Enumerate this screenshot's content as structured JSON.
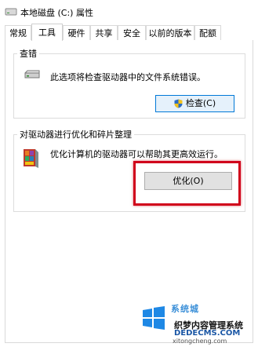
{
  "window": {
    "title": "本地磁盘 (C:) 属性"
  },
  "tabs": [
    {
      "label": "常规"
    },
    {
      "label": "工具",
      "active": true
    },
    {
      "label": "硬件"
    },
    {
      "label": "共享"
    },
    {
      "label": "安全"
    },
    {
      "label": "以前的版本"
    },
    {
      "label": "配额"
    }
  ],
  "error_checking": {
    "legend": "查错",
    "description": "此选项将检查驱动器中的文件系统错误。",
    "button_label": "检查(C)",
    "button_icon": "uac-shield-icon"
  },
  "optimize": {
    "legend": "对驱动器进行优化和碎片整理",
    "description": "优化计算机的驱动器可以帮助其更高效运行。",
    "button_label": "优化(O)",
    "highlight_color": "#d0021b"
  },
  "watermark": {
    "brand": "系统城",
    "site_name": "织梦内容管理系统",
    "domain_upper": "DEDECMS.COM",
    "domain_lower": "xitongcheng.com"
  }
}
